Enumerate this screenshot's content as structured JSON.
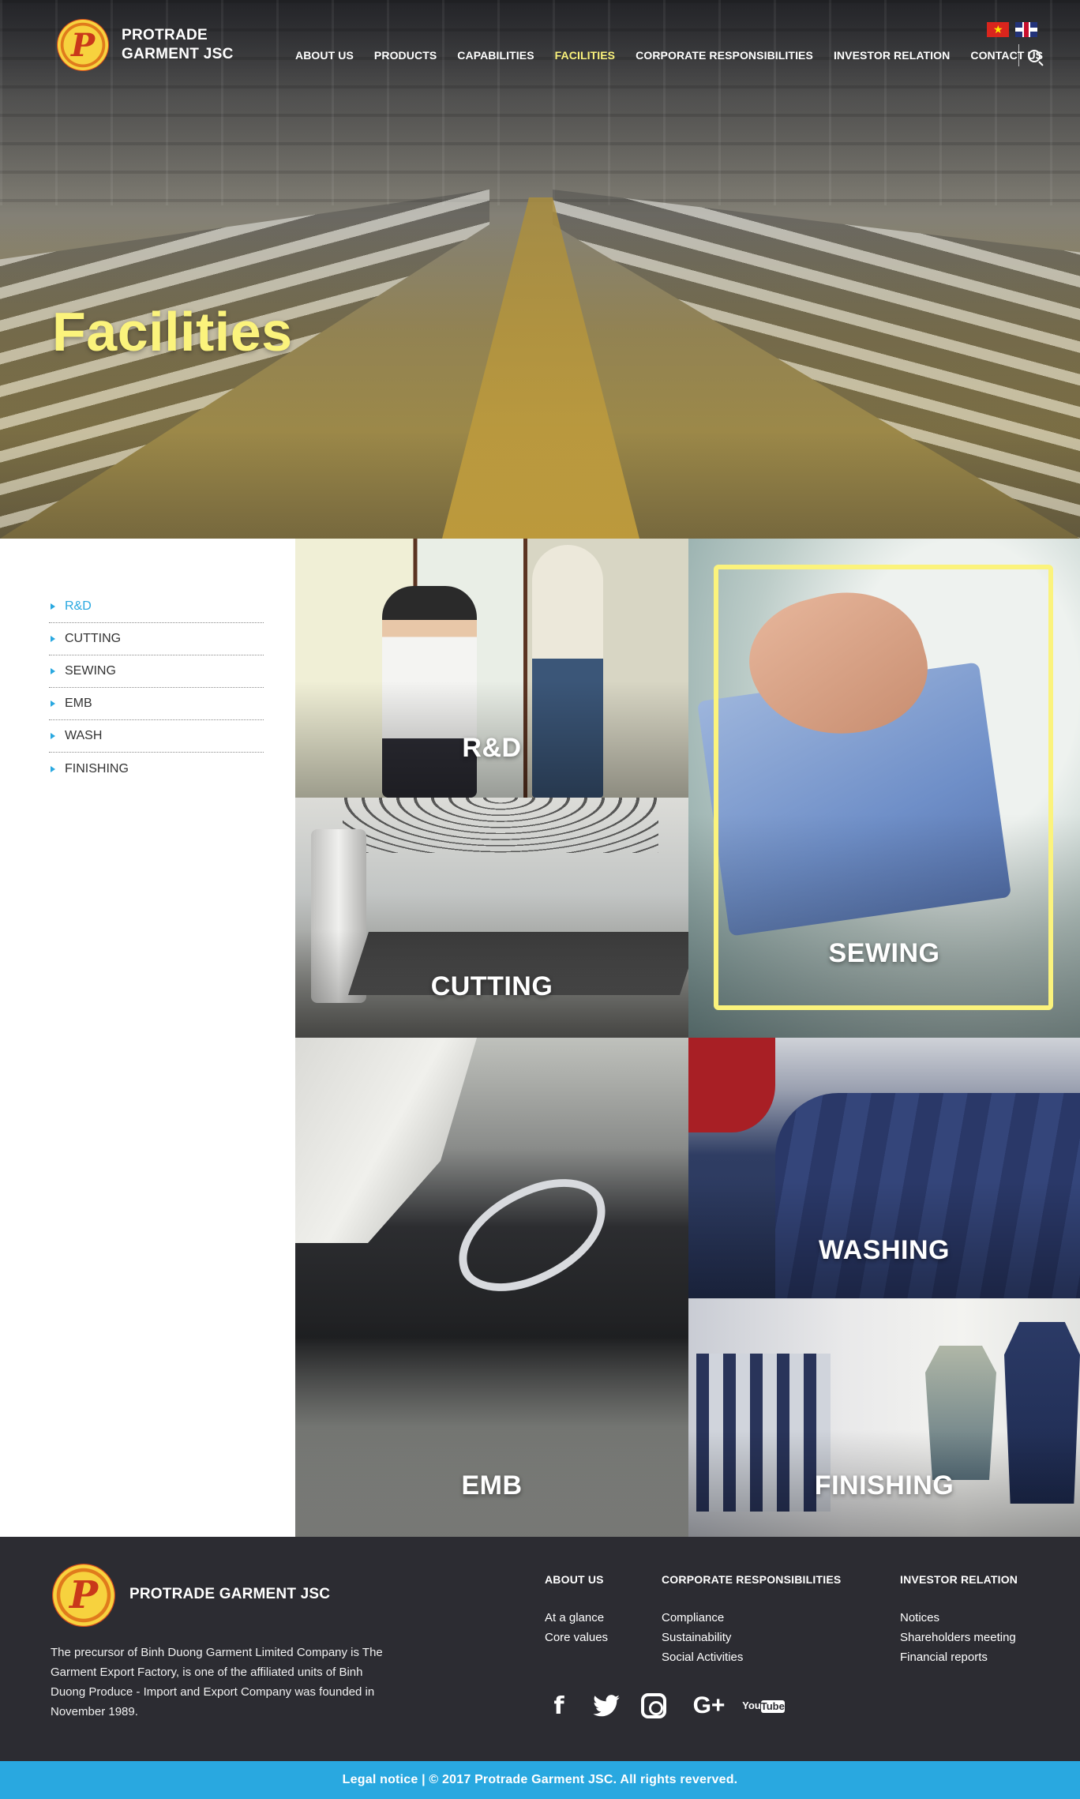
{
  "header": {
    "brand_line1": "PROTRADE",
    "brand_line2": "GARMENT JSC",
    "nav": [
      {
        "label": "ABOUT US"
      },
      {
        "label": "PRODUCTS"
      },
      {
        "label": "CAPABILITIES"
      },
      {
        "label": "FACILITIES",
        "active": true
      },
      {
        "label": "CORPORATE RESPONSIBILITIES"
      },
      {
        "label": "INVESTOR RELATION"
      },
      {
        "label": "CONTACT US"
      }
    ],
    "languages": [
      "vietnam-flag-icon",
      "uk-flag-icon"
    ],
    "search_icon": "search-icon"
  },
  "hero": {
    "title": "Facilities"
  },
  "sidebar": {
    "items": [
      {
        "label": "R&D",
        "active": true
      },
      {
        "label": "CUTTING"
      },
      {
        "label": "SEWING"
      },
      {
        "label": "EMB"
      },
      {
        "label": "WASH"
      },
      {
        "label": "FINISHING"
      }
    ]
  },
  "tiles": {
    "rd": "R&D",
    "cutting": "CUTTING",
    "sewing": "SEWING",
    "emb": "EMB",
    "washing": "WASHING",
    "finishing": "FINISHING"
  },
  "footer": {
    "brand": "PROTRADE GARMENT JSC",
    "description": "The precursor of Binh Duong Garment Limited Company is The Garment Export Factory, is one of the affiliated units of Binh Duong Produce - Import and Export Company was founded in November 1989.",
    "columns": [
      {
        "title": "ABOUT US",
        "links": [
          "At a glance",
          "Core values"
        ]
      },
      {
        "title": "CORPORATE RESPONSIBILITIES",
        "links": [
          "Compliance",
          "Sustainability",
          "Social Activities"
        ]
      },
      {
        "title": "INVESTOR RELATION",
        "links": [
          "Notices",
          "Shareholders meeting",
          "Financial reports"
        ]
      }
    ],
    "social": {
      "facebook": "f",
      "googleplus": "G+",
      "youtube_top": "You",
      "youtube_bottom": "Tube"
    },
    "legal": "Legal notice | © 2017 Protrade Garment JSC. All rights reverved."
  },
  "colors": {
    "accent_blue": "#29a8e0",
    "highlight_yellow": "#fbf37c",
    "footer_bg": "#2c2c32"
  }
}
